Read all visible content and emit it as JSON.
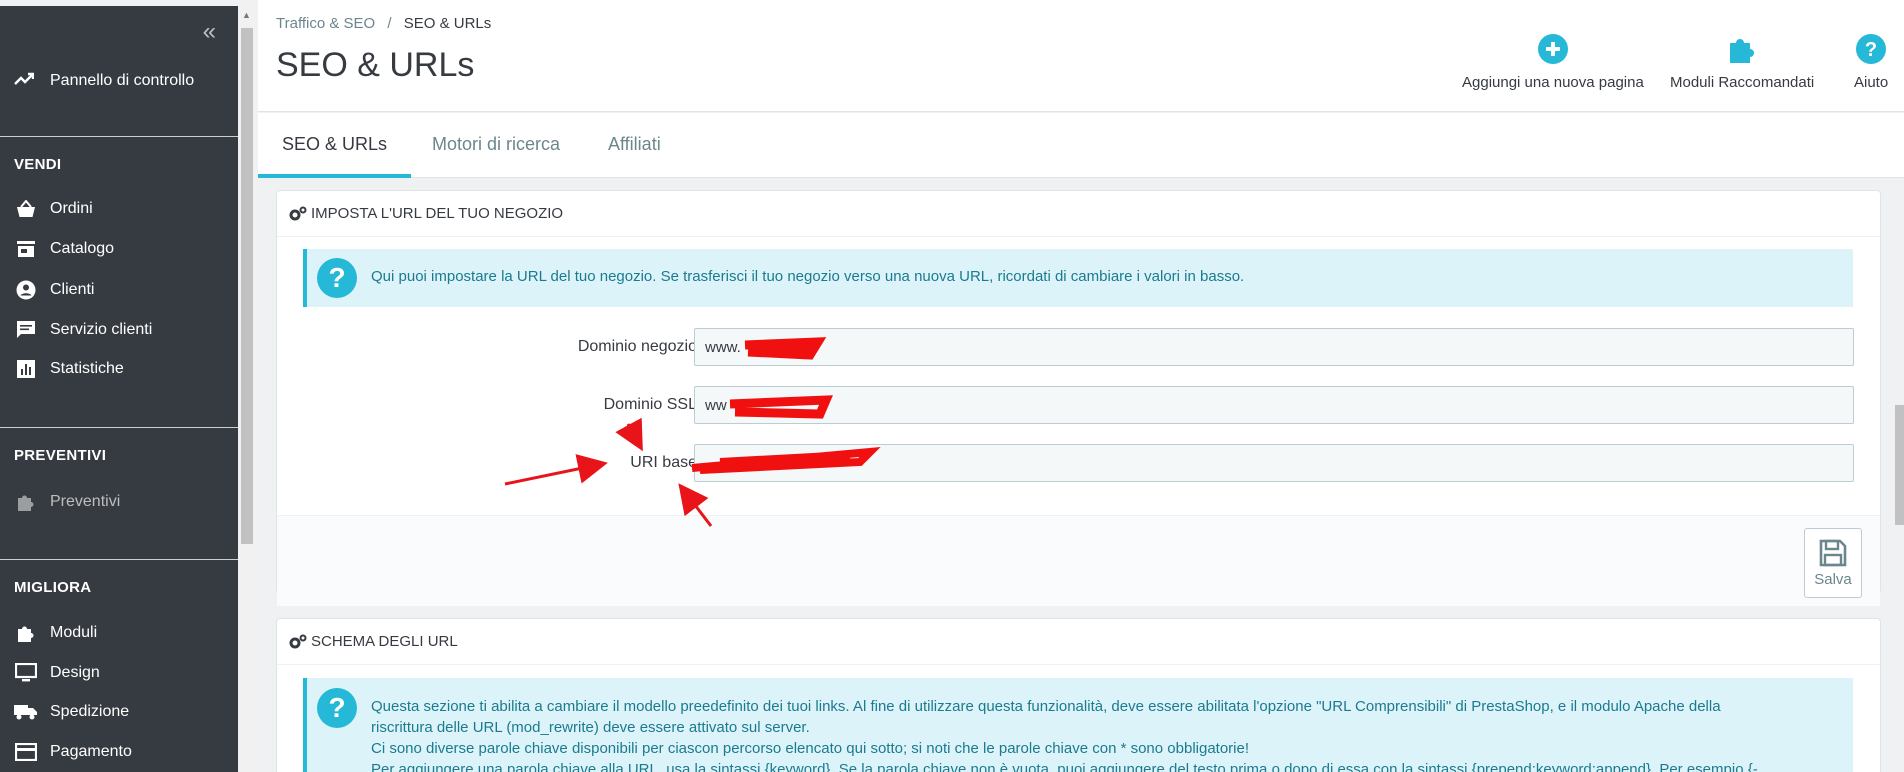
{
  "sidebar": {
    "collapse_icon": "«",
    "dashboard_label": "Pannello di controllo",
    "sections": [
      {
        "title": "VENDI",
        "items": [
          {
            "label": "Ordini",
            "icon": "basket-icon"
          },
          {
            "label": "Catalogo",
            "icon": "store-icon"
          },
          {
            "label": "Clienti",
            "icon": "user-circle-icon"
          },
          {
            "label": "Servizio clienti",
            "icon": "chat-icon"
          },
          {
            "label": "Statistiche",
            "icon": "bar-chart-icon"
          }
        ]
      },
      {
        "title": "PREVENTIVI",
        "items": [
          {
            "label": "Preventivi",
            "icon": "puzzle-icon"
          }
        ]
      },
      {
        "title": "MIGLIORA",
        "items": [
          {
            "label": "Moduli",
            "icon": "puzzle-icon"
          },
          {
            "label": "Design",
            "icon": "monitor-icon"
          },
          {
            "label": "Spedizione",
            "icon": "truck-icon"
          },
          {
            "label": "Pagamento",
            "icon": "credit-card-icon"
          }
        ]
      }
    ]
  },
  "header": {
    "breadcrumb": {
      "parent": "Traffico & SEO",
      "separator": "/",
      "current": "SEO & URLs"
    },
    "title": "SEO & URLs",
    "toolbar": {
      "add_page": "Aggiungi una nuova pagina",
      "recommended_modules": "Moduli Raccomandati",
      "help": "Aiuto"
    },
    "accent_color": "#25b9d7"
  },
  "tabs": [
    {
      "label": "SEO & URLs",
      "active": true
    },
    {
      "label": "Motori di ricerca",
      "active": false
    },
    {
      "label": "Affiliati",
      "active": false
    }
  ],
  "shop_url_panel": {
    "title": "IMPOSTA L'URL DEL TUO NEGOZIO",
    "info": "Qui puoi impostare la URL del tuo negozio. Se trasferisci il tuo negozio verso una nuova URL, ricordati di cambiare i valori in basso.",
    "fields": {
      "domain_label": "Dominio negozio",
      "domain_value": "www.",
      "ssl_label": "Dominio SSL",
      "ssl_value": "ww",
      "base_uri_label": "URI base",
      "base_uri_value": ""
    },
    "save_label": "Salva"
  },
  "url_schema_panel": {
    "title": "SCHEMA DEGLI URL",
    "info_lines": [
      "Questa sezione ti abilita a cambiare il modello preedefinito dei tuoi links. Al fine di utilizzare questa funzionalità, deve essere abilitata l'opzione \"URL Comprensibili\" di PrestaShop, e il modulo Apache della",
      "riscrittura delle URL (mod_rewrite) deve essere attivato sul server.",
      "Ci sono diverse parole chiave disponibili per ciascon percorso elencato qui sotto; si noti che le parole chiave con * sono obbligatorie!",
      "Per aggiungere una parola chiave alla URL, usa la sintassi {keyword}. Se la parola chiave non è vuota, puoi aggiungere del testo prima o dopo di essa con la sintassi {prepend:keyword:append}. Per esempio {-"
    ]
  }
}
